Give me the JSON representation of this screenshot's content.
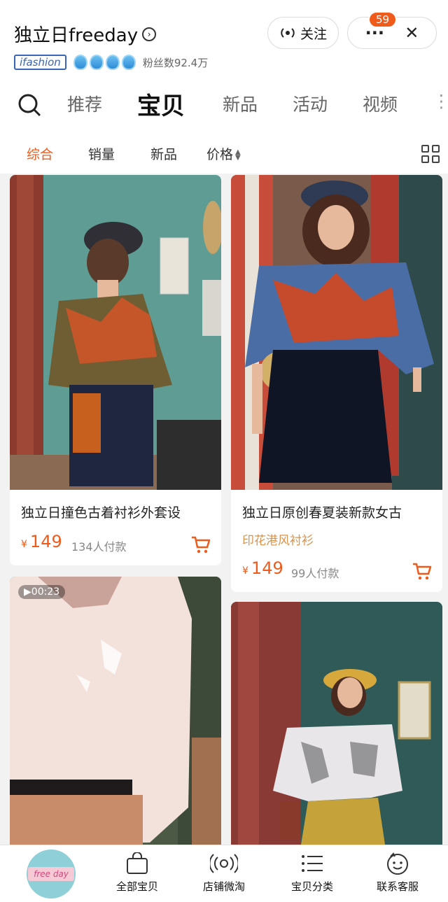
{
  "header": {
    "shop_name": "独立日freeday",
    "brand_badge": "ifashion",
    "fans": "粉丝数92.4万",
    "follow_label": "关注",
    "notification_count": "59"
  },
  "tabs": [
    "推荐",
    "宝贝",
    "新品",
    "活动",
    "视频"
  ],
  "active_tab": "宝贝",
  "sort": {
    "items": [
      "综合",
      "销量",
      "新品",
      "价格"
    ],
    "active": "综合"
  },
  "products": [
    {
      "title": "独立日撞色古着衬衫外套设",
      "currency": "¥",
      "price": "149",
      "sold": "134人付款"
    },
    {
      "title": "独立日原创春夏装新款女古",
      "subtitle": "印花港风衬衫",
      "currency": "¥",
      "price": "149",
      "sold": "99人付款"
    },
    {
      "video_duration": "00:23"
    },
    {}
  ],
  "bottom_nav": {
    "logo_text": "free day",
    "items": [
      "全部宝贝",
      "店铺微淘",
      "宝贝分类",
      "联系客服"
    ]
  },
  "colors": {
    "accent": "#f05a1a",
    "subtitle": "#d8934e"
  }
}
